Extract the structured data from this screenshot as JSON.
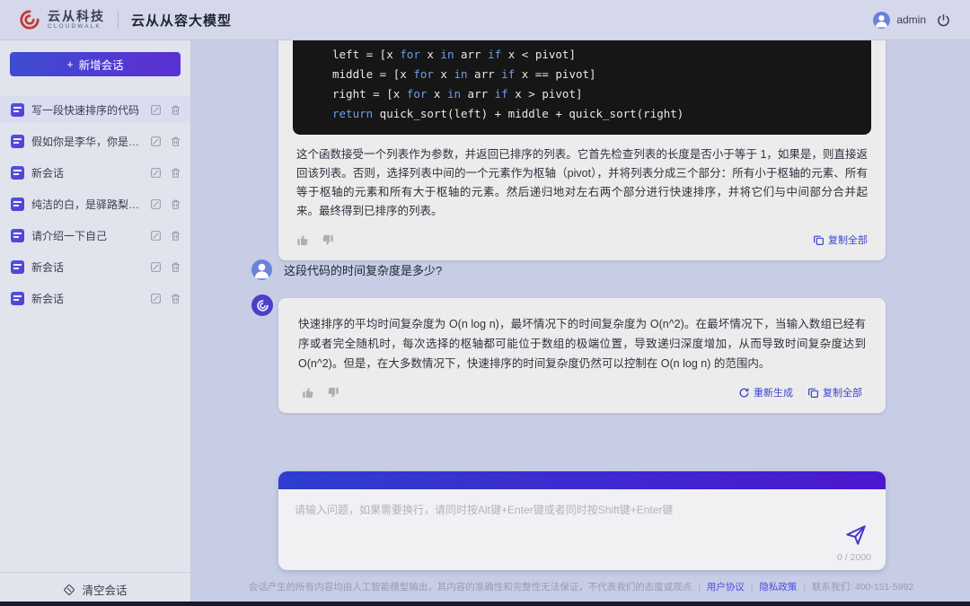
{
  "header": {
    "brand_cn": "云从科技",
    "brand_en": "CLOUDWALK",
    "app_title": "云从从容大模型",
    "username": "admin"
  },
  "sidebar": {
    "new_chat_plus": "+",
    "new_chat_label": "新增会话",
    "items": [
      {
        "label": "写一段快速排序的代码",
        "active": true
      },
      {
        "label": "假如你是李华，你是一...",
        "active": false
      },
      {
        "label": "新会话",
        "active": false
      },
      {
        "label": "纯洁的白，是驿路梨花...",
        "active": false
      },
      {
        "label": "请介绍一下自己",
        "active": false
      },
      {
        "label": "新会话",
        "active": false
      },
      {
        "label": "新会话",
        "active": false
      }
    ],
    "clear_label": "清空会话"
  },
  "conversation": {
    "assistant_code_message": {
      "code_lines": [
        "left = [x for x in arr if x < pivot]",
        "middle = [x for x in arr if x == pivot]",
        "right = [x for x in arr if x > pivot]",
        "return quick_sort(left) + middle + quick_sort(right)"
      ],
      "explanation": "这个函数接受一个列表作为参数，并返回已排序的列表。它首先检查列表的长度是否小于等于 1，如果是，则直接返回该列表。否则，选择列表中间的一个元素作为枢轴（pivot），并将列表分成三个部分：所有小于枢轴的元素、所有等于枢轴的元素和所有大于枢轴的元素。然后递归地对左右两个部分进行快速排序，并将它们与中间部分合并起来。最终得到已排序的列表。",
      "copy_label": "复制全部"
    },
    "user_message": {
      "text": "这段代码的时间复杂度是多少?"
    },
    "assistant_reply": {
      "text": "快速排序的平均时间复杂度为 O(n log n)，最坏情况下的时间复杂度为 O(n^2)。在最坏情况下，当输入数组已经有序或者完全随机时，每次选择的枢轴都可能位于数组的极端位置，导致递归深度增加，从而导致时间复杂度达到 O(n^2)。但是，在大多数情况下，快速排序的时间复杂度仍然可以控制在 O(n log n) 的范围内。",
      "regenerate_label": "重新生成",
      "copy_label": "复制全部"
    }
  },
  "composer": {
    "placeholder": "请输入问题，如果需要换行，请同时按Alt键+Enter键或者同时按Shift键+Enter键",
    "char_count": "0 / 2000"
  },
  "footer": {
    "disclaimer": "会话产生的所有内容均由人工智能模型输出，其内容的准确性和完整性无法保证，不代表我们的态度或观点",
    "separator": "|",
    "terms_label": "用户协议",
    "privacy_label": "隐私政策",
    "contact_label": "联系我们: 400-151-5992"
  },
  "colors": {
    "accent_purple": "#4c3fd2",
    "brand_red": "#c43a32",
    "page_background": "#c7cde5",
    "card_background": "#ececec",
    "code_background": "#161616",
    "code_keyword": "#6e9ee8",
    "button_gradient_start": "#3e4cd2",
    "button_gradient_end": "#5c2fd2"
  }
}
